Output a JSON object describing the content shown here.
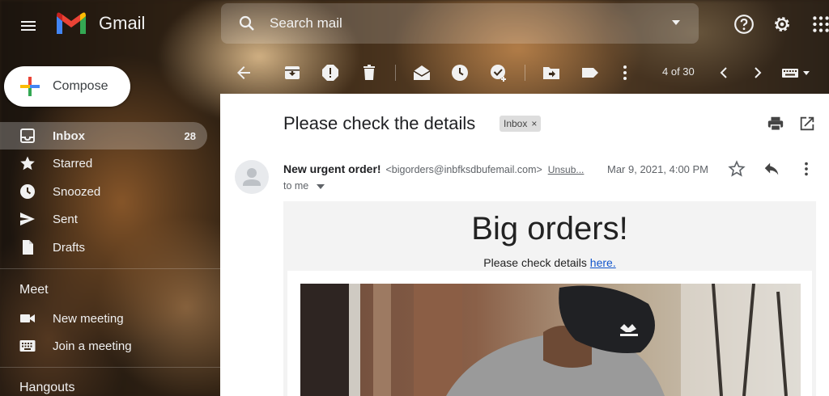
{
  "app": {
    "brand": "Gmail",
    "search_placeholder": "Search mail"
  },
  "sidebar": {
    "compose_label": "Compose",
    "items": [
      {
        "label": "Inbox",
        "count": "28",
        "icon": "inbox-icon"
      },
      {
        "label": "Starred",
        "icon": "star-icon"
      },
      {
        "label": "Snoozed",
        "icon": "clock-icon"
      },
      {
        "label": "Sent",
        "icon": "send-icon"
      },
      {
        "label": "Drafts",
        "icon": "draft-icon"
      }
    ],
    "meet": {
      "title": "Meet",
      "items": [
        {
          "label": "New meeting",
          "icon": "video-icon"
        },
        {
          "label": "Join a meeting",
          "icon": "keyboard-icon"
        }
      ]
    },
    "hangouts_title": "Hangouts"
  },
  "toolbar": {
    "pager": "4 of 30"
  },
  "email": {
    "subject": "Please check the details",
    "label_chip": "Inbox",
    "label_remove": "×",
    "sender_name": "New urgent order!",
    "sender_email": "<bigorders@inbfksdbufemail.com>",
    "unsubscribe": "Unsub...",
    "date": "Mar 9, 2021, 4:00 PM",
    "to": "to me",
    "body": {
      "heading": "Big orders!",
      "line_prefix": "Please check details",
      "link_text": "here."
    }
  },
  "colors": {
    "accent_blue": "#1155cc",
    "content_bg": "#ffffff",
    "email_body_bg": "#f3f3f3"
  }
}
